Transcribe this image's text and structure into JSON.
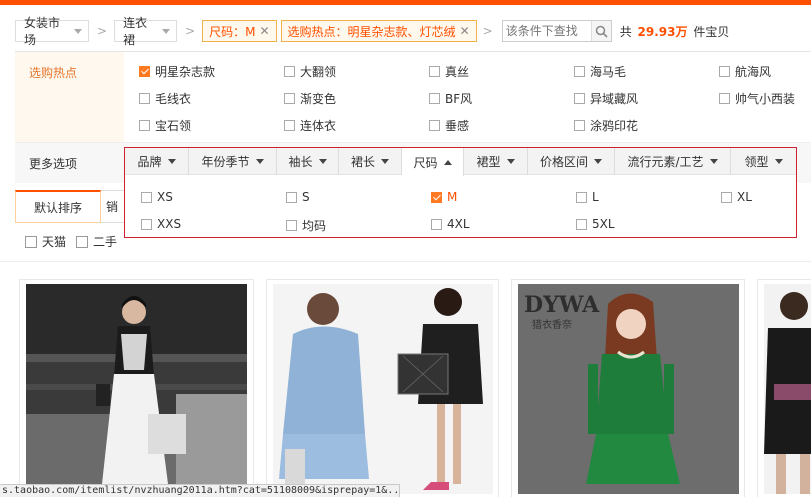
{
  "breadcrumb": {
    "level1": "女装市场",
    "level2": "连衣裙",
    "chip_size": "尺码：M",
    "chip_hot": "选购热点：明星杂志款、灯芯绒",
    "search_placeholder": "该条件下查找",
    "total_prefix": "共",
    "total_count": "29.93万",
    "total_suffix": "件宝贝"
  },
  "hot_filter": {
    "label": "选购热点",
    "items": [
      {
        "label": "明星杂志款",
        "checked": true
      },
      {
        "label": "大翻领",
        "checked": false
      },
      {
        "label": "真丝",
        "checked": false
      },
      {
        "label": "海马毛",
        "checked": false
      },
      {
        "label": "航海风",
        "checked": false
      },
      {
        "label": "毛线衣",
        "checked": false
      },
      {
        "label": "渐变色",
        "checked": false
      },
      {
        "label": "BF风",
        "checked": false
      },
      {
        "label": "异域藏风",
        "checked": false
      },
      {
        "label": "帅气小西装",
        "checked": false
      },
      {
        "label": "宝石领",
        "checked": false
      },
      {
        "label": "连体衣",
        "checked": false
      },
      {
        "label": "垂感",
        "checked": false
      },
      {
        "label": "涂鸦印花",
        "checked": false
      }
    ]
  },
  "more_options": {
    "label": "更多选项",
    "tabs": [
      "品牌",
      "年份季节",
      "袖长",
      "裙长",
      "尺码",
      "裙型",
      "价格区间",
      "流行元素/工艺",
      "领型"
    ],
    "active_tab": "尺码",
    "sizes": [
      {
        "label": "XS",
        "checked": false
      },
      {
        "label": "S",
        "checked": false
      },
      {
        "label": "M",
        "checked": true
      },
      {
        "label": "L",
        "checked": false
      },
      {
        "label": "XL",
        "checked": false
      },
      {
        "label": "XXS",
        "checked": false
      },
      {
        "label": "均码",
        "checked": false
      },
      {
        "label": "4XL",
        "checked": false
      },
      {
        "label": "5XL",
        "checked": false
      }
    ]
  },
  "sort": {
    "default_label": "默认排序",
    "second_label": "销"
  },
  "quick_filters": [
    {
      "label": "天猫",
      "checked": false
    },
    {
      "label": "二手",
      "checked": false
    }
  ],
  "products": {
    "brand_text": "DYWA",
    "brand_sub": "猎衣香奈"
  },
  "status_bar": "s.taobao.com/itemlist/nvzhuang2011a.htm?cat=51108009&isprepay=1&..."
}
